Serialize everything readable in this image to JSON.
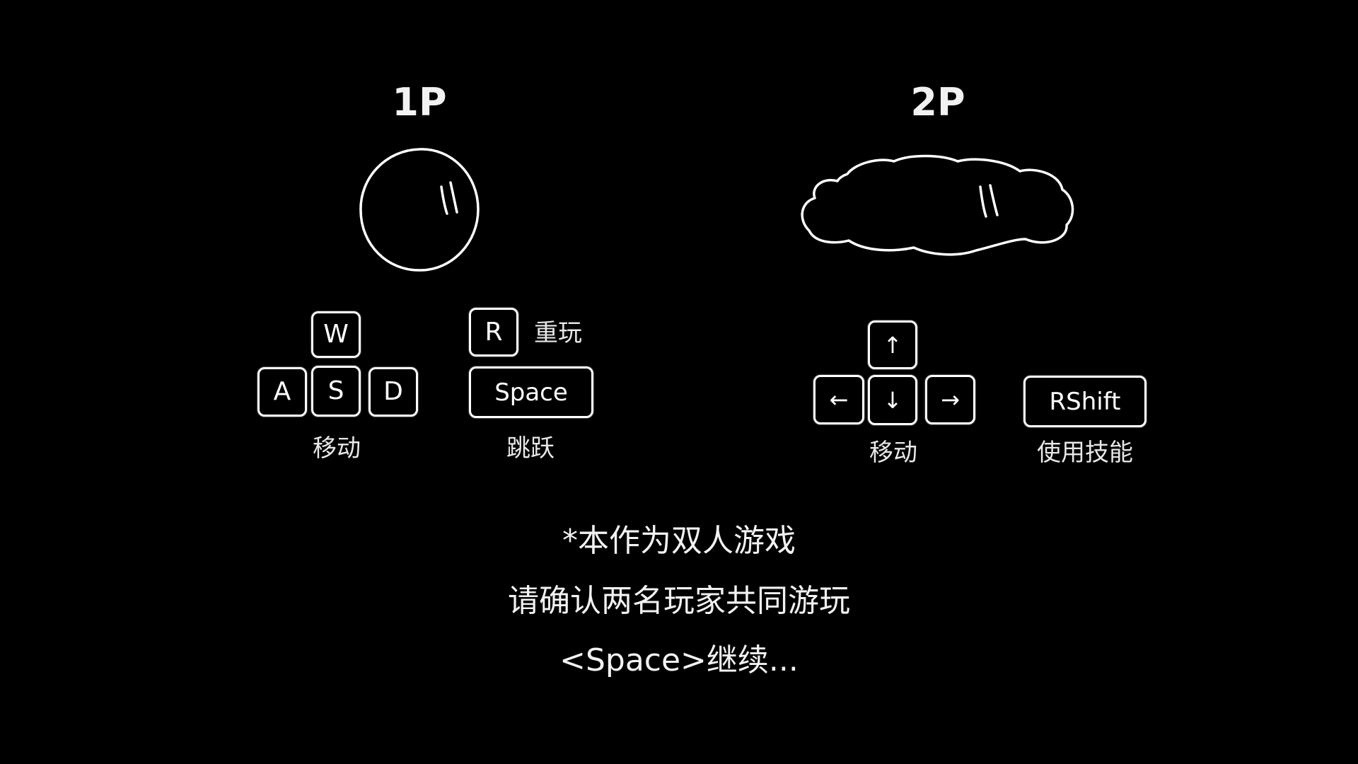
{
  "player1": {
    "title": "1P",
    "avatar_icon": "ball-icon",
    "keys": {
      "up": "W",
      "left": "A",
      "down": "S",
      "right": "D",
      "replay": "R",
      "jump": "Space"
    },
    "labels": {
      "move": "移动",
      "replay": "重玩",
      "jump": "跳跃"
    }
  },
  "player2": {
    "title": "2P",
    "avatar_icon": "cloud-icon",
    "keys": {
      "up": "↑",
      "left": "←",
      "down": "↓",
      "right": "→",
      "skill": "RShift"
    },
    "labels": {
      "move": "移动",
      "skill": "使用技能"
    }
  },
  "notice": {
    "line1": "*本作为双人游戏",
    "line2": "请确认两名玩家共同游玩",
    "continue": "<Space>继续..."
  },
  "colors": {
    "background": "#000000",
    "foreground": "#ffffff"
  }
}
